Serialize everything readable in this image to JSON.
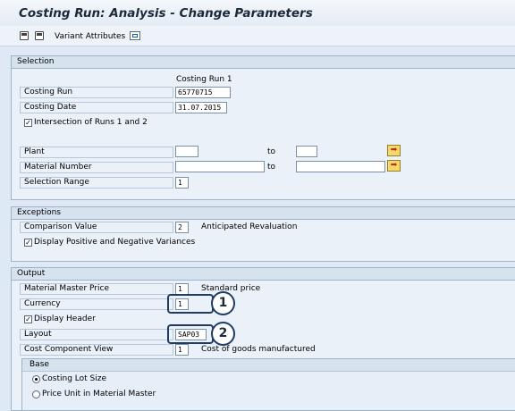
{
  "window": {
    "title": "Costing Run: Analysis - Change Parameters"
  },
  "toolbar": {
    "save_variant_icon": "save-icon",
    "get_variant_icon": "get-variant-icon",
    "variant_attributes_label": "Variant Attributes",
    "detail_icon": "detail-icon"
  },
  "selection": {
    "title": "Selection",
    "column_header": "Costing Run 1",
    "costing_run_label": "Costing Run",
    "costing_run_value": "65770715",
    "costing_date_label": "Costing Date",
    "costing_date_value": "31.07.2015",
    "intersection_label": "Intersection of Runs 1 and 2",
    "intersection_checked": true,
    "plant_label": "Plant",
    "plant_from": "",
    "plant_to_label": "to",
    "plant_to": "",
    "material_label": "Material Number",
    "material_from": "",
    "material_to_label": "to",
    "material_to": "",
    "selection_range_label": "Selection Range",
    "selection_range_value": "1",
    "multiple_selection_icon": "arrow-right-icon"
  },
  "exceptions": {
    "title": "Exceptions",
    "comparison_label": "Comparison Value",
    "comparison_value": "2",
    "comparison_text": "Anticipated Revaluation",
    "display_variances_label": "Display Positive and Negative Variances",
    "display_variances_checked": true
  },
  "output": {
    "title": "Output",
    "price_label": "Material Master Price",
    "price_value": "1",
    "price_text": "Standard price",
    "currency_label": "Currency",
    "currency_value": "1",
    "display_header_label": "Display Header",
    "display_header_checked": true,
    "layout_label": "Layout",
    "layout_value": "SAP03",
    "ccv_label": "Cost Component View",
    "ccv_value": "1",
    "ccv_text": "Cost of goods manufactured",
    "callouts": [
      "1",
      "2"
    ],
    "base": {
      "title": "Base",
      "options": [
        "Costing Lot Size",
        "Price Unit in Material Master"
      ],
      "selected_index": 0
    }
  },
  "colors": {
    "background": "#dfe9f5",
    "group_header": "#d6e2ee",
    "callout": "#1f3b66",
    "multiple_selection_button": "#f5d86b"
  }
}
